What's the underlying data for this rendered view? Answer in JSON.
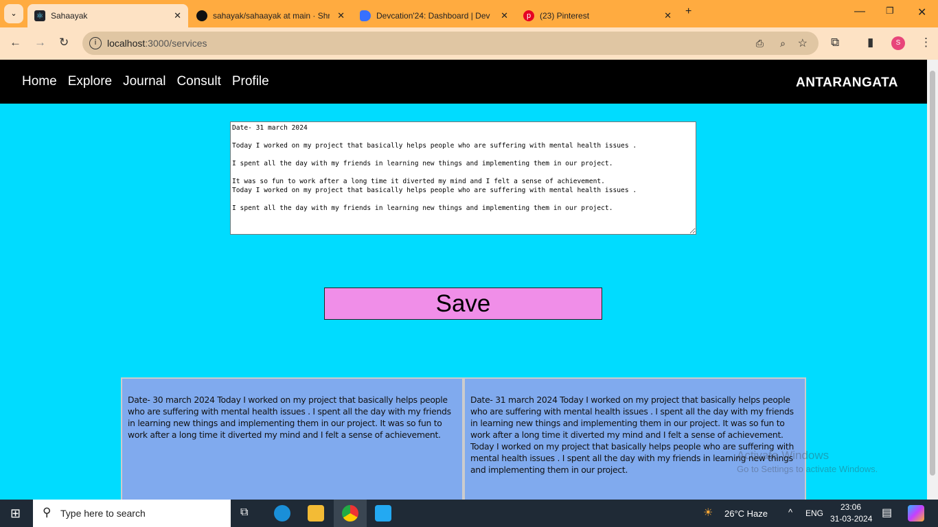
{
  "browser": {
    "tabs": [
      {
        "title": "Sahaayak",
        "active": true,
        "icon": "react-icon"
      },
      {
        "title": "sahayak/sahaayak at main · Shr",
        "icon": "github-icon"
      },
      {
        "title": "Devcation'24: Dashboard | Dev",
        "icon": "devfolio-icon"
      },
      {
        "title": "(23) Pinterest",
        "icon": "pinterest-icon"
      }
    ],
    "url_host": "localhost",
    "url_path": ":3000/services",
    "profile_initial": "S"
  },
  "navbar": {
    "links": [
      "Home",
      "Explore",
      "Journal",
      "Consult",
      "Profile"
    ],
    "brand": "ANTARANGATA"
  },
  "journal": {
    "text": "Date- 31 march 2024\n\nToday I worked on my project that basically helps people who are suffering with mental health issues .\n\nI spent all the day with my friends in learning new things and implementing them in our project.\n\nIt was so fun to work after a long time it diverted my mind and I felt a sense of achievement.\nToday I worked on my project that basically helps people who are suffering with mental health issues .\n\nI spent all the day with my friends in learning new things and implementing them in our project.",
    "save_label": "Save"
  },
  "entries": [
    "Date- 30 march 2024 Today I worked on my project that basically helps people who are suffering with mental health issues . I spent all the day with my friends in learning new things and implementing them in our project. It was so fun to work after a long time it diverted my mind and I felt a sense of achievement.",
    "Date- 31 march 2024 Today I worked on my project that basically helps people who are suffering with mental health issues . I spent all the day with my friends in learning new things and implementing them in our project. It was so fun to work after a long time it diverted my mind and I felt a sense of achievement. Today I worked on my project that basically helps people who are suffering with mental health issues . I spent all the day with my friends in learning new things and implementing them in our project."
  ],
  "watermark": {
    "line1": "Activate Windows",
    "line2": "Go to Settings to activate Windows."
  },
  "taskbar": {
    "search_placeholder": "Type here to search",
    "weather": "26°C  Haze",
    "lang": "ENG",
    "time": "23:06",
    "date": "31-03-2024"
  },
  "colors": {
    "page_bg": "#00dcff",
    "save_bg": "#f08ee8",
    "card_bg": "#80aaee",
    "navbar_bg": "#000000"
  }
}
